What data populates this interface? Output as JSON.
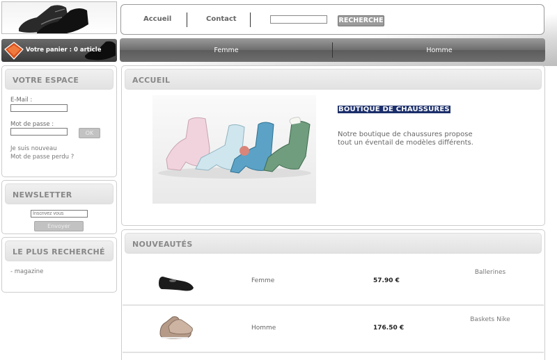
{
  "header": {
    "nav": [
      "Accueil",
      "Contact"
    ],
    "search": {
      "value": "",
      "button_label": "RECHERCHE"
    }
  },
  "cart": {
    "label": "Votre panier : 0 article"
  },
  "main_nav": [
    "Femme",
    "Homme"
  ],
  "sidebar": {
    "account": {
      "title": "VOTRE ESPACE",
      "email_label": "E-Mail :",
      "password_label": "Mot de passe :",
      "ok_label": "OK",
      "new_user_link": "Je suis nouveau",
      "forgot_link": "Mot de passe perdu ?"
    },
    "newsletter": {
      "title": "NEWSLETTER",
      "placeholder": "Inscrivez vous",
      "button_label": "Envoyer"
    },
    "popular": {
      "title": "LE PLUS RECHERCHÉ",
      "items": [
        "- magazine"
      ]
    }
  },
  "home": {
    "title": "ACCUEIL",
    "shop_title": "BOUTIQUE DE CHAUSSURES",
    "description": "Notre boutique de chaussures propose tout un éventail de modèles différents."
  },
  "news": {
    "title": "NOUVEAUTÉS",
    "products": [
      {
        "category": "Femme",
        "price": "57.90 €",
        "name": "Ballerines",
        "icon": "ballerina-shoe-icon"
      },
      {
        "category": "Homme",
        "price": "176.50 €",
        "name": "Baskets Nike",
        "icon": "sneaker-icon"
      }
    ]
  },
  "colors": {
    "highlight": "#1c2f6b",
    "nav_bar": "#6d6d6d"
  }
}
